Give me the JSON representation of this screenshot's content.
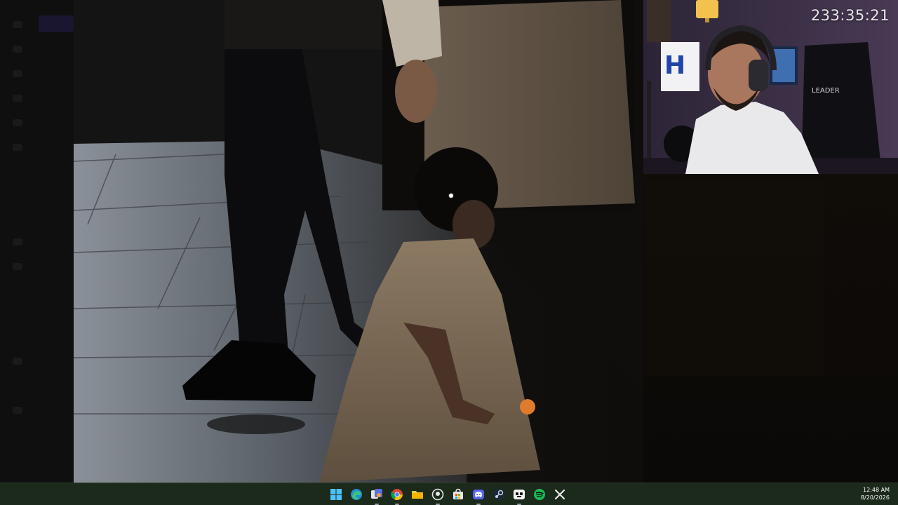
{
  "stream": {
    "uptime_timer": "233:35:21"
  },
  "photo_viewer": {
    "alt": "photo"
  },
  "taskbar": {
    "icons": [
      {
        "name": "windows-start-icon"
      },
      {
        "name": "edge-icon"
      },
      {
        "name": "app-icon"
      },
      {
        "name": "chrome-icon"
      },
      {
        "name": "file-explorer-icon"
      },
      {
        "name": "github-icon"
      },
      {
        "name": "store-icon"
      },
      {
        "name": "discord-icon"
      },
      {
        "name": "steam-icon"
      },
      {
        "name": "game-app-icon"
      },
      {
        "name": "spotify-icon"
      },
      {
        "name": "capcut-icon"
      }
    ],
    "clock": {
      "time": "12:48 AM",
      "date": "8/20/2026"
    }
  },
  "colors": {
    "taskbar_bg": "#1c2a1c",
    "timer_text": "#e8e8ec",
    "spotify_green": "#1db954",
    "discord_blurple": "#5865f2"
  }
}
